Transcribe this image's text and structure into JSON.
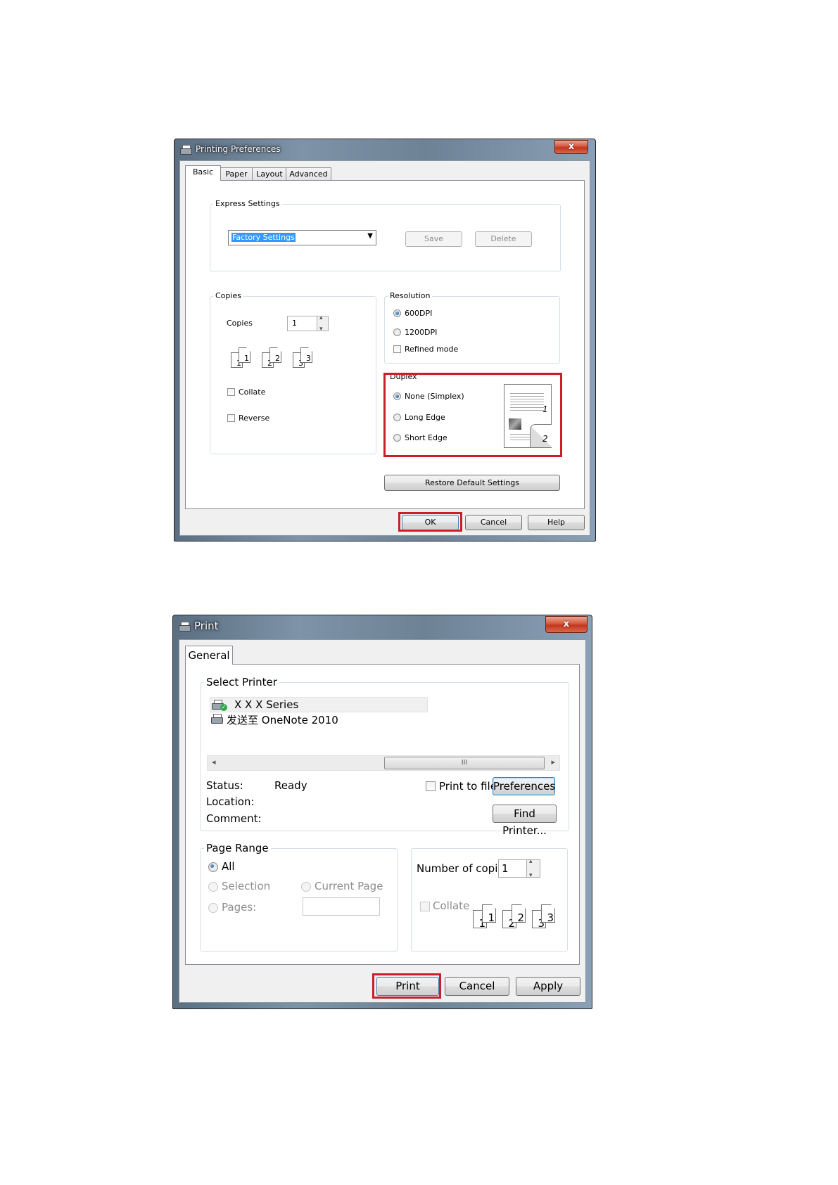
{
  "preferences_dialog": {
    "title": "Printing Preferences",
    "close_label": "x",
    "tabs": [
      "Basic",
      "Paper",
      "Layout",
      "Advanced"
    ],
    "express_settings": {
      "legend": "Express Settings",
      "selected_value": "Factory Settings",
      "save_label": "Save",
      "delete_label": "Delete"
    },
    "copies": {
      "legend": "Copies",
      "copies_label": "Copies",
      "copies_value": "1",
      "collate_label": "Collate",
      "collate_checked": false,
      "reverse_label": "Reverse",
      "reverse_checked": false,
      "collate_icons": [
        "1",
        "1",
        "2",
        "2",
        "3",
        "3"
      ]
    },
    "resolution": {
      "legend": "Resolution",
      "options": [
        "600DPI",
        "1200DPI"
      ],
      "selected": "600DPI",
      "refined_mode_label": "Refined mode",
      "refined_mode_checked": false
    },
    "duplex": {
      "legend": "Duplex",
      "options": [
        "None (Simplex)",
        "Long Edge",
        "Short Edge"
      ],
      "selected": "None (Simplex)",
      "preview_page_numbers": [
        "1",
        "2"
      ]
    },
    "restore_label": "Restore Default Settings",
    "ok_label": "OK",
    "cancel_label": "Cancel",
    "help_label": "Help"
  },
  "print_dialog": {
    "title": "Print",
    "close_label": "x",
    "tab": "General",
    "select_printer": {
      "legend": "Select Printer",
      "printers": [
        "X X X   Series",
        "发送至 OneNote 2010"
      ],
      "scroll_thumb": "III"
    },
    "status_label": "Status:",
    "status_value": "Ready",
    "location_label": "Location:",
    "comment_label": "Comment:",
    "print_to_file_label": "Print to file",
    "preferences_label": "Preferences",
    "find_printer_label": "Find Printer...",
    "page_range": {
      "legend": "Page Range",
      "all_label": "All",
      "selection_label": "Selection",
      "current_page_label": "Current Page",
      "pages_label": "Pages:",
      "selected": "All"
    },
    "copies": {
      "number_label": "Number of copies:",
      "number_value": "1",
      "collate_label": "Collate",
      "collate_icons": [
        "1",
        "1",
        "2",
        "2",
        "3",
        "3"
      ]
    },
    "print_label": "Print",
    "cancel_label": "Cancel",
    "apply_label": "Apply"
  },
  "colors": {
    "highlight_red": "#c8202a",
    "selection_blue": "#3399ff",
    "close_red": "#c0361d"
  }
}
